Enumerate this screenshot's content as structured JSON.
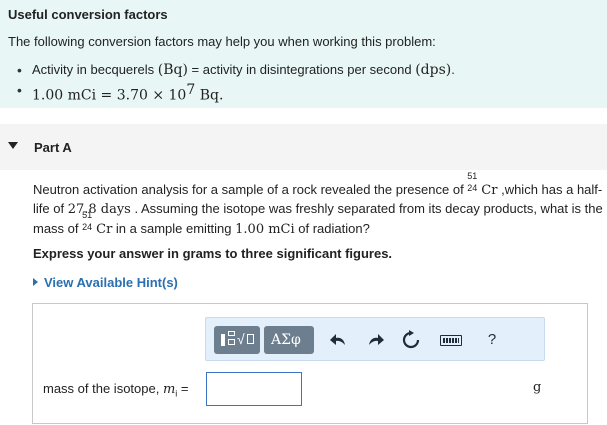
{
  "conversion": {
    "title": "Useful conversion factors",
    "subtitle": "The following conversion factors may help you when working this problem:",
    "item1_prefix": "Activity in becquerels ",
    "item1_bq": "(Bq)",
    "item1_mid": " = activity in disintegrations per second ",
    "item1_dps": "(dps)",
    "item1_end": ".",
    "item2_lhs": "1.00 mCi = 3.70 × 10",
    "item2_exp": "7",
    "item2_rhs": " Bq."
  },
  "part": {
    "title": "Part A",
    "text1": "Neutron activation analysis for a sample of a rock revealed the presence of ",
    "iso_mass": "51",
    "iso_num": "24",
    "iso_sym": "Cr",
    "text2": " ,which has a half-life of ",
    "half_life": "27.8 days",
    "text3": " . Assuming the isotope was freshly separated from its decay products, what is the mass of ",
    "text4": " in a sample emitting ",
    "activity": "1.00 mCi",
    "text5": " of radiation?",
    "instruction": "Express your answer in grams to three significant figures.",
    "hint_link": "View Available Hint(s)"
  },
  "answer": {
    "greek_label": "ΑΣφ",
    "undo_icon": "undo-icon",
    "redo_icon": "redo-icon",
    "reset_icon": "reset-icon",
    "keyboard_icon": "keyboard-icon",
    "help_label": "?",
    "label_prefix": "mass of the isotope, ",
    "label_var": "m",
    "label_sub": "i",
    "label_eq": " =",
    "input_value": "",
    "unit": "g"
  }
}
